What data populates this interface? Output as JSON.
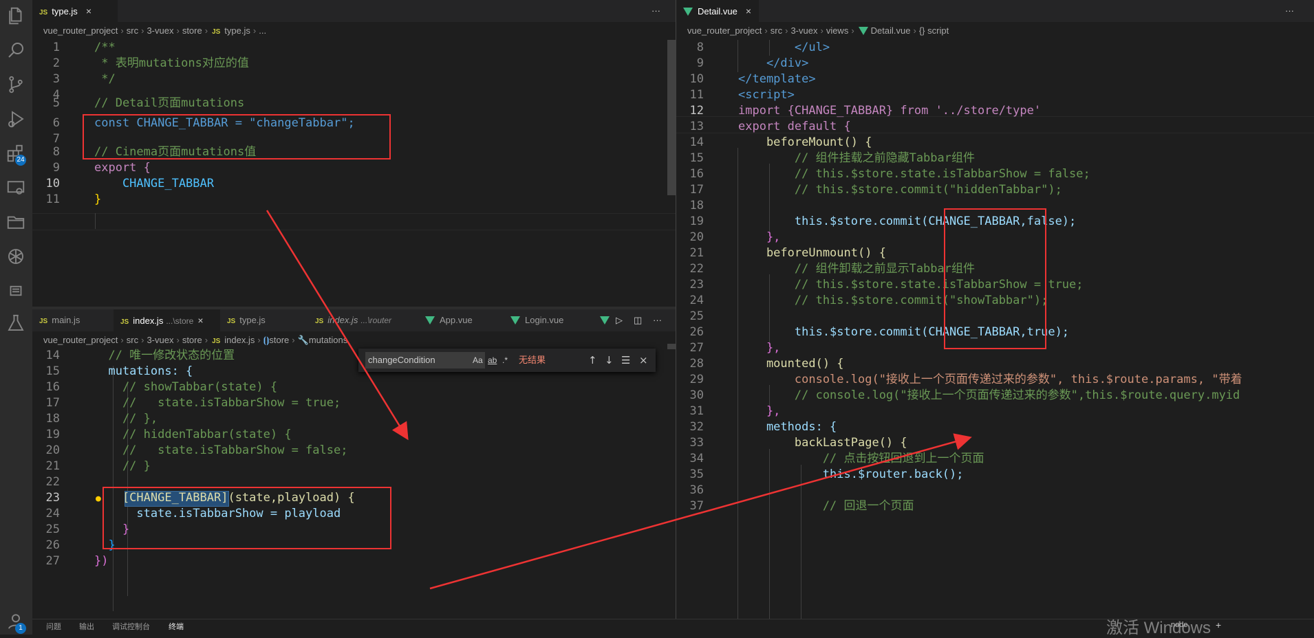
{
  "top_left": {
    "tab": {
      "label": "type.js",
      "close": "×"
    },
    "breadcrumb": [
      "vue_router_project",
      "src",
      "3-vuex",
      "store",
      "type.js",
      "..."
    ],
    "more": "···"
  },
  "bottom_left": {
    "tabs": [
      {
        "label": "main.js"
      },
      {
        "label": "index.js",
        "hint": "...\\store",
        "close": "×"
      },
      {
        "label": "type.js"
      },
      {
        "label": "index.js",
        "hint": "...\\router"
      },
      {
        "label": "App.vue"
      },
      {
        "label": "Login.vue"
      }
    ],
    "breadcrumb": [
      "vue_router_project",
      "src",
      "3-vuex",
      "store",
      "index.js",
      "store",
      "mutations"
    ],
    "actions": {
      "run": "▷",
      "split": "◫",
      "more": "···"
    }
  },
  "find_widget": {
    "value": "changeCondition",
    "options": [
      "Aa",
      "ab",
      ".*"
    ],
    "result": "无结果",
    "prev": "↑",
    "next": "↓",
    "selection": "☰",
    "close": "×"
  },
  "right": {
    "tab": {
      "label": "Detail.vue",
      "close": "×"
    },
    "breadcrumb": [
      "vue_router_project",
      "src",
      "3-vuex",
      "views",
      "Detail.vue",
      "{} script"
    ],
    "more": "···"
  },
  "activity": {
    "extensions_badge": "24",
    "account_badge": "1",
    "icons": [
      "files-icon",
      "search-icon",
      "source-control-icon",
      "run-debug-icon",
      "extensions-icon",
      "remote-icon",
      "explorer-folder-icon",
      "openai-icon",
      "list-icon",
      "testing-icon",
      "account-icon"
    ]
  },
  "panel": {
    "tabs": [
      "问题",
      "输出",
      "调试控制台",
      "终端"
    ],
    "terminal_label": "node",
    "plus": "+"
  },
  "watermark": "激活 Windows",
  "code": {
    "type_js": [
      {
        "n": "1",
        "t": "/**"
      },
      {
        "n": "2",
        "t": " * 表明mutations对应的值"
      },
      {
        "n": "3",
        "t": " */"
      },
      {
        "n": "4",
        "t": ""
      },
      {
        "n": "5",
        "t": "// Detail页面mutations"
      },
      {
        "n": "6",
        "t": "const CHANGE_TABBAR = \"changeTabbar\";"
      },
      {
        "n": "7",
        "t": ""
      },
      {
        "n": "8",
        "t": "// Cinema页面mutations值"
      },
      {
        "n": "9",
        "t": "export {"
      },
      {
        "n": "10",
        "t": "    CHANGE_TABBAR"
      },
      {
        "n": "11",
        "t": "}"
      }
    ],
    "index_js": [
      {
        "n": "14",
        "t": "  // 唯一修改状态的位置"
      },
      {
        "n": "15",
        "t": "  mutations: {"
      },
      {
        "n": "16",
        "t": "    // showTabbar(state) {"
      },
      {
        "n": "17",
        "t": "    //   state.isTabbarShow = true;"
      },
      {
        "n": "18",
        "t": "    // },"
      },
      {
        "n": "19",
        "t": "    // hiddenTabbar(state) {"
      },
      {
        "n": "20",
        "t": "    //   state.isTabbarShow = false;"
      },
      {
        "n": "21",
        "t": "    // }"
      },
      {
        "n": "22",
        "t": ""
      },
      {
        "n": "23",
        "t": "    [CHANGE_TABBAR](state,playload) {"
      },
      {
        "n": "24",
        "t": "      state.isTabbarShow = playload"
      },
      {
        "n": "25",
        "t": "    }"
      },
      {
        "n": "26",
        "t": "  }"
      },
      {
        "n": "27",
        "t": "})"
      }
    ],
    "detail_vue": [
      {
        "n": "8",
        "t": "        </ul>"
      },
      {
        "n": "9",
        "t": "    </div>"
      },
      {
        "n": "10",
        "t": "</template>"
      },
      {
        "n": "11",
        "t": "<script>"
      },
      {
        "n": "12",
        "t": "import {CHANGE_TABBAR} from '../store/type'"
      },
      {
        "n": "13",
        "t": "export default {"
      },
      {
        "n": "14",
        "t": "    beforeMount() {"
      },
      {
        "n": "15",
        "t": "        // 组件挂载之前隐藏Tabbar组件"
      },
      {
        "n": "16",
        "t": "        // this.$store.state.isTabbarShow = false;"
      },
      {
        "n": "17",
        "t": "        // this.$store.commit(\"hiddenTabbar\");"
      },
      {
        "n": "18",
        "t": ""
      },
      {
        "n": "19",
        "t": "        this.$store.commit(CHANGE_TABBAR,false);"
      },
      {
        "n": "20",
        "t": "    },"
      },
      {
        "n": "21",
        "t": "    beforeUnmount() {"
      },
      {
        "n": "22",
        "t": "        // 组件卸载之前显示Tabbar组件"
      },
      {
        "n": "23",
        "t": "        // this.$store.state.isTabbarShow = true;"
      },
      {
        "n": "24",
        "t": "        // this.$store.commit(\"showTabbar\");"
      },
      {
        "n": "25",
        "t": ""
      },
      {
        "n": "26",
        "t": "        this.$store.commit(CHANGE_TABBAR,true);"
      },
      {
        "n": "27",
        "t": "    },"
      },
      {
        "n": "28",
        "t": "    mounted() {"
      },
      {
        "n": "29",
        "t": "        console.log(\"接收上一个页面传递过来的参数\", this.$route.params, \"带着"
      },
      {
        "n": "30",
        "t": "        // console.log(\"接收上一个页面传递过来的参数\",this.$route.query.myid"
      },
      {
        "n": "31",
        "t": "    },"
      },
      {
        "n": "32",
        "t": "    methods: {"
      },
      {
        "n": "33",
        "t": "        backLastPage() {"
      },
      {
        "n": "34",
        "t": "            // 点击按钮回退到上一个页面"
      },
      {
        "n": "35",
        "t": "            this.$router.back();"
      },
      {
        "n": "36",
        "t": ""
      },
      {
        "n": "37",
        "t": "            // 回退一个页面"
      }
    ]
  },
  "colors": {
    "annotation_red": "#ee3333",
    "background": "#1e1e1e",
    "tab_bar": "#252526"
  }
}
